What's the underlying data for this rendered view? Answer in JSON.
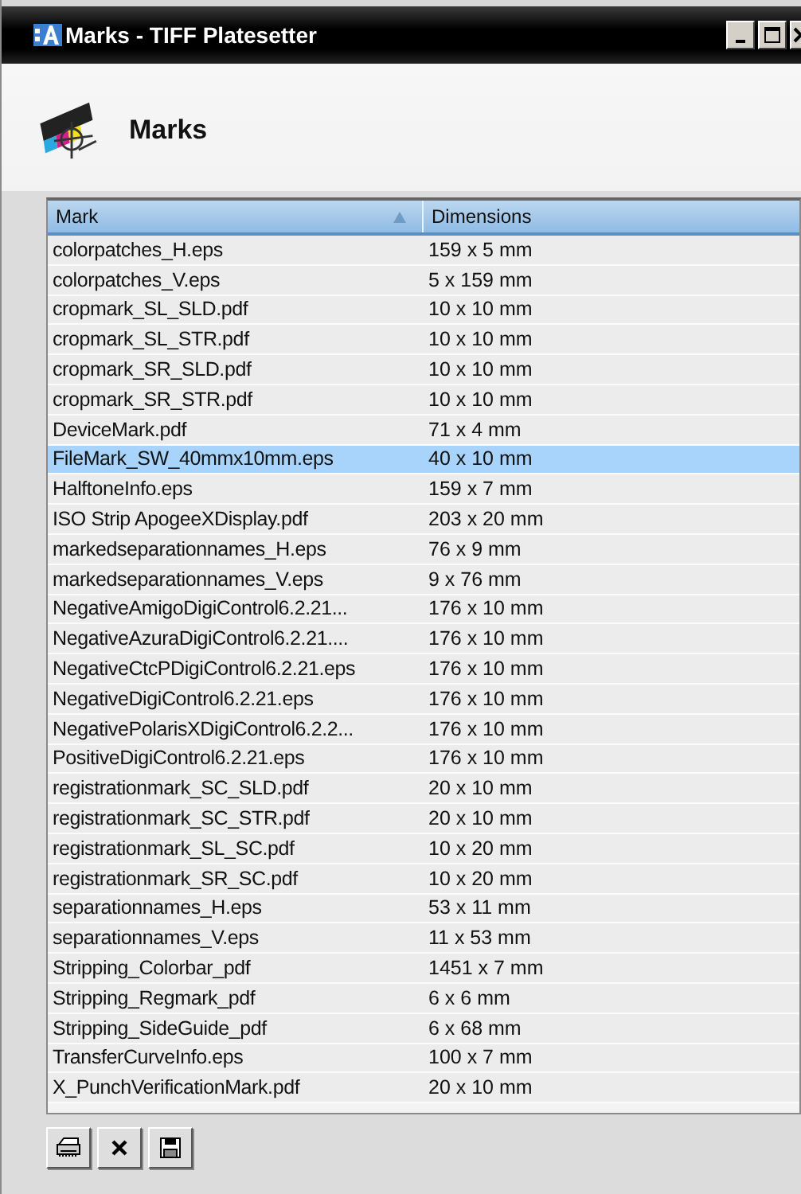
{
  "window": {
    "title": "Marks - TIFF Platesetter"
  },
  "header": {
    "title": "Marks"
  },
  "table": {
    "columns": [
      {
        "label": "Mark",
        "sorted": true
      },
      {
        "label": "Dimensions",
        "sorted": false
      }
    ],
    "rows": [
      {
        "mark": "colorpatches_H.eps",
        "dimensions": "159 x 5 mm",
        "selected": false
      },
      {
        "mark": "colorpatches_V.eps",
        "dimensions": "5 x 159 mm",
        "selected": false
      },
      {
        "mark": "cropmark_SL_SLD.pdf",
        "dimensions": "10 x 10 mm",
        "selected": false
      },
      {
        "mark": "cropmark_SL_STR.pdf",
        "dimensions": "10 x 10 mm",
        "selected": false
      },
      {
        "mark": "cropmark_SR_SLD.pdf",
        "dimensions": "10 x 10 mm",
        "selected": false
      },
      {
        "mark": "cropmark_SR_STR.pdf",
        "dimensions": "10 x 10 mm",
        "selected": false
      },
      {
        "mark": "DeviceMark.pdf",
        "dimensions": "71 x 4 mm",
        "selected": false
      },
      {
        "mark": "FileMark_SW_40mmx10mm.eps",
        "dimensions": "40 x 10 mm",
        "selected": true
      },
      {
        "mark": "HalftoneInfo.eps",
        "dimensions": "159 x 7 mm",
        "selected": false
      },
      {
        "mark": "ISO Strip ApogeeXDisplay.pdf",
        "dimensions": "203 x 20 mm",
        "selected": false
      },
      {
        "mark": "markedseparationnames_H.eps",
        "dimensions": "76 x 9 mm",
        "selected": false
      },
      {
        "mark": "markedseparationnames_V.eps",
        "dimensions": "9 x 76 mm",
        "selected": false
      },
      {
        "mark": "NegativeAmigoDigiControl6.2.21...",
        "dimensions": "176 x 10 mm",
        "selected": false
      },
      {
        "mark": "NegativeAzuraDigiControl6.2.21....",
        "dimensions": "176 x 10 mm",
        "selected": false
      },
      {
        "mark": "NegativeCtcPDigiControl6.2.21.eps",
        "dimensions": "176 x 10 mm",
        "selected": false
      },
      {
        "mark": "NegativeDigiControl6.2.21.eps",
        "dimensions": "176 x 10 mm",
        "selected": false
      },
      {
        "mark": "NegativePolarisXDigiControl6.2.2...",
        "dimensions": "176 x 10 mm",
        "selected": false
      },
      {
        "mark": "PositiveDigiControl6.2.21.eps",
        "dimensions": "176 x 10 mm",
        "selected": false
      },
      {
        "mark": "registrationmark_SC_SLD.pdf",
        "dimensions": "20 x 10 mm",
        "selected": false
      },
      {
        "mark": "registrationmark_SC_STR.pdf",
        "dimensions": "20 x 10 mm",
        "selected": false
      },
      {
        "mark": "registrationmark_SL_SC.pdf",
        "dimensions": "10 x 20 mm",
        "selected": false
      },
      {
        "mark": "registrationmark_SR_SC.pdf",
        "dimensions": "10 x 20 mm",
        "selected": false
      },
      {
        "mark": "separationnames_H.eps",
        "dimensions": "53 x 11 mm",
        "selected": false
      },
      {
        "mark": "separationnames_V.eps",
        "dimensions": "11 x 53 mm",
        "selected": false
      },
      {
        "mark": "Stripping_Colorbar_pdf",
        "dimensions": "1451 x 7 mm",
        "selected": false
      },
      {
        "mark": "Stripping_Regmark_pdf",
        "dimensions": "6 x 6 mm",
        "selected": false
      },
      {
        "mark": "Stripping_SideGuide_pdf",
        "dimensions": "6 x 68 mm",
        "selected": false
      },
      {
        "mark": "TransferCurveInfo.eps",
        "dimensions": "100 x 7 mm",
        "selected": false
      },
      {
        "mark": "X_PunchVerificationMark.pdf",
        "dimensions": "20 x 10 mm",
        "selected": false
      }
    ]
  }
}
